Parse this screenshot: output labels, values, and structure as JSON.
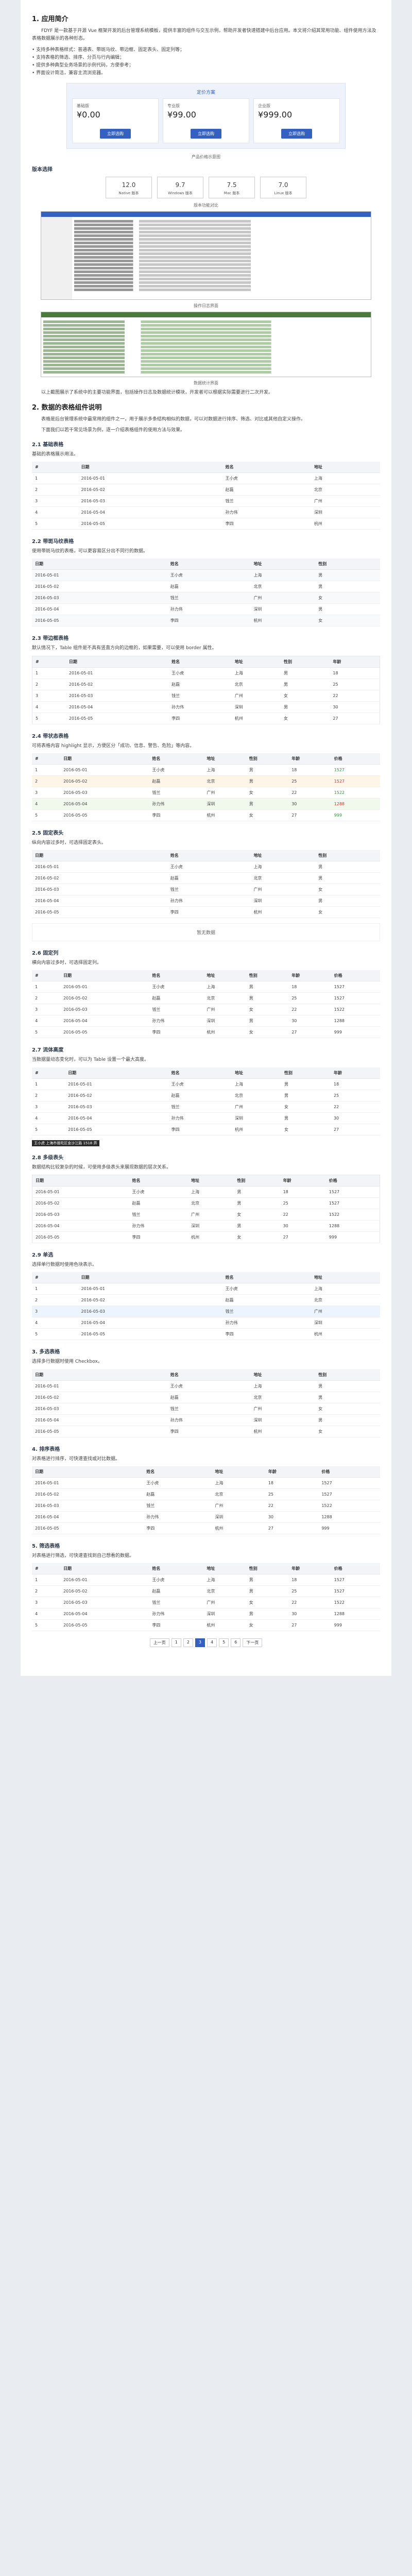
{
  "sec1": {
    "title": "1. 应用简介",
    "para": "FDYF 是一款基于开源 Vue 框架开发的后台管理系统模板，提供丰富的组件与交互示例，帮助开发者快速搭建中后台应用。本文将介绍其常用功能、组件使用方法及表格数据展示的各种形态。",
    "list": "• 支持多种表格样式：普通表、带斑马纹、带边框、固定表头、固定列等；\n• 支持表格的筛选、排序、分页与行内编辑；\n• 提供多种典型业务场景的示例代码，方便参考；\n• 界面设计简洁，兼容主流浏览器。"
  },
  "pricing": {
    "head": "定价方案",
    "cards": [
      {
        "name": "基础版",
        "amount": "¥0.00",
        "button": "立即选购"
      },
      {
        "name": "专业版",
        "amount": "¥99.00",
        "button": "立即选购"
      },
      {
        "name": "企业版",
        "amount": "¥999.00",
        "button": "立即选购"
      }
    ],
    "caption": "产品价格示意图"
  },
  "software": {
    "title": "版本选择",
    "cards": [
      {
        "ver": "12.0",
        "label": "Native 版本"
      },
      {
        "ver": "9.7",
        "label": "Windows 版本"
      },
      {
        "ver": "7.5",
        "label": "Mac 版本"
      },
      {
        "ver": "7.0",
        "label": "Linux 版本"
      }
    ],
    "caption": "版本功能对比"
  },
  "shot1_caption": "操作日志界面",
  "shot2_caption": "数据统计界面",
  "note_after": "以上截图展示了系统中的主要功能界面，包括操作日志及数据统计模块，开发者可以根据实际需要进行二次开发。",
  "sec2": {
    "title": "2. 数据的表格组件说明",
    "para1": "表格是后台管理系统中最常用的组件之一，用于展示多条结构相似的数据，可以对数据进行排序、筛选、对比或其他自定义操作。",
    "para2": "下面我们以若干常见场景为例，逐一介绍表格组件的使用方法与效果。"
  },
  "tables": {
    "headers": {
      "no": "#",
      "date": "日期",
      "name": "姓名",
      "addr": "地址",
      "gender": "性别",
      "age": "年龄",
      "price": "价格"
    },
    "rows": [
      {
        "no": "1",
        "date": "2016-05-01",
        "name": "王小虎",
        "addr": "上海",
        "gender": "男",
        "age": "18",
        "price": "1527"
      },
      {
        "no": "2",
        "date": "2016-05-02",
        "name": "赵磊",
        "addr": "北京",
        "gender": "男",
        "age": "25",
        "price": "1527"
      },
      {
        "no": "3",
        "date": "2016-05-03",
        "name": "钱兰",
        "addr": "广州",
        "gender": "女",
        "age": "22",
        "price": "1522"
      },
      {
        "no": "4",
        "date": "2016-05-04",
        "name": "孙力伟",
        "addr": "深圳",
        "gender": "男",
        "age": "30",
        "price": "1288"
      },
      {
        "no": "5",
        "date": "2016-05-05",
        "name": "李四",
        "addr": "杭州",
        "gender": "女",
        "age": "27",
        "price": "999"
      }
    ],
    "t1_title": "2.1 基础表格",
    "t1_desc": "基础的表格展示用法。",
    "t2_title": "2.2 带斑马纹表格",
    "t2_desc": "使用带斑马纹的表格，可以更容易区分出不同行的数据。",
    "t3_title": "2.3 带边框表格",
    "t3_desc": "默认情况下，Table 组件是不具有竖直方向的边框的，如果需要，可以使用 border 属性。",
    "t4_title": "2.4 带状态表格",
    "t4_desc": "可将表格内容 highlight 显示，方便区分「成功、信息、警告、危险」等内容。",
    "t5_title": "2.5 固定表头",
    "t5_desc": "纵向内容过多时，可选择固定表头。",
    "t6_title": "2.6 固定列",
    "t6_desc": "横向内容过多时，可选择固定列。",
    "t7_title": "2.7 流体高度",
    "t7_desc": "当数据量动态变化时，可以为 Table 设置一个最大高度。",
    "t8_title": "2.8 多级表头",
    "t8_desc": "数据结构比较复杂的时候，可使用多级表头来展现数据的层次关系。",
    "t9_title": "2.9 单选",
    "t9_desc": "选择单行数据时使用色块表示。",
    "t10_title": "3. 多选表格",
    "t10_desc": "选择多行数据时使用 Checkbox。",
    "empty_note": "暂无数据",
    "tooltip": "王小虎 上海市普陀区金沙江路 1518 弄",
    "t11_title": "4. 排序表格",
    "t11_desc": "对表格进行排序，可快速查找或对比数据。",
    "t12_title": "5. 筛选表格",
    "t12_desc": "对表格进行筛选，可快速查找到自己想看的数据。"
  },
  "pager": {
    "prev": "上一页",
    "next": "下一页",
    "pages": [
      "1",
      "2",
      "3",
      "4",
      "5",
      "6"
    ],
    "current": "3"
  }
}
